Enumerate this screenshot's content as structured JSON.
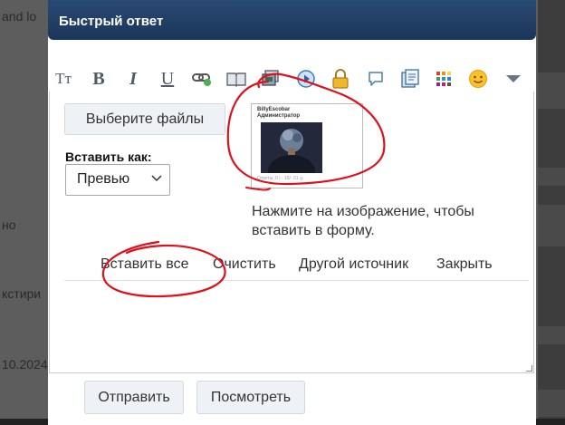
{
  "background": {
    "text_1": "and lo",
    "text_2": "но",
    "text_3": "кстири",
    "text_4": "10.2024"
  },
  "modal": {
    "title": "Быстрый ответ"
  },
  "toolbar": {
    "icons": [
      "text-size-icon",
      "bold-icon",
      "italic-icon",
      "underline-icon",
      "link-icon",
      "book-icon",
      "image-icon",
      "media-play-icon",
      "lock-icon",
      "speech-bubble-icon",
      "quote-icon",
      "color-grid-icon",
      "smiley-icon",
      "dropdown-arrow-icon"
    ]
  },
  "upload": {
    "choose_files": "Выберите файлы",
    "insert_as_label": "Вставить как:",
    "insert_as_value": "Превью",
    "thumb_username": "BillyEscobar",
    "thumb_role": "Администратор",
    "thumb_footer": "Ответы: 0 | · 15/· 01 ◎",
    "hint": "Нажмите на изображение, чтобы вставить в форму.",
    "insert_all": "Вставить все",
    "clear": "Очистить",
    "other_source": "Другой источник",
    "close": "Закрыть"
  },
  "form": {
    "send": "Отправить",
    "preview": "Посмотреть"
  },
  "colors": {
    "titlebar": "#1b3558",
    "annotation_red": "#e0101a"
  }
}
